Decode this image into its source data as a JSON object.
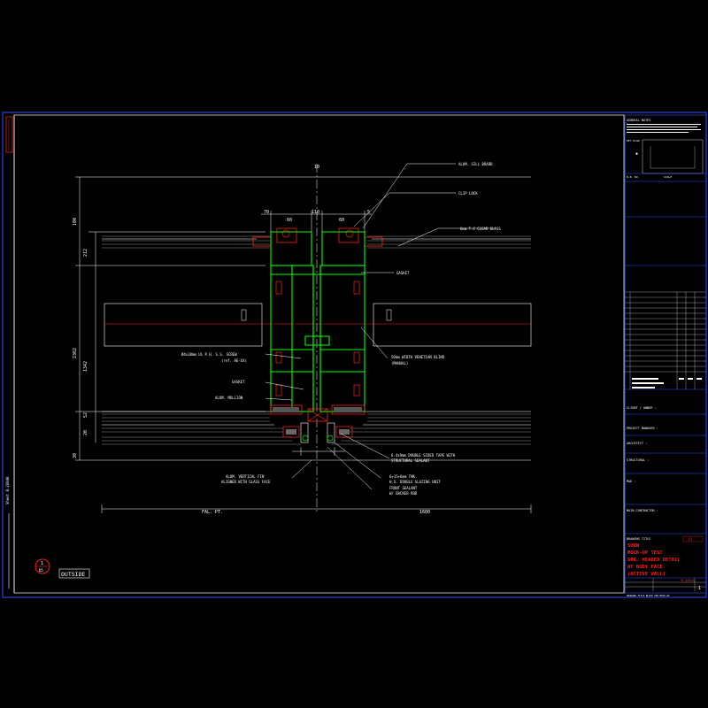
{
  "drawing": {
    "labels": {
      "wall_board": "ALUM. SILL BOARD",
      "clip_lock": "CLIP LOCK",
      "clear_glass": "6mm T.C CLEAR GLASS",
      "gasket_top": "GASKET",
      "blind": "50mm WIDTH VENETIAN BLIND",
      "blind_2": "(MANUAL)",
      "screw": "Ø4x38mm UL P.H. S.S. SCREW",
      "screw_2": "(ref. AE-XX)",
      "gasket_left": "GASKET",
      "mullion": "ALUM. MULLION",
      "tape": "6.4x9mm DOUBLE SIDED TAPE WITH",
      "tape_2": "STRUCTURAL SEALANT",
      "glazing": "6+15+6mm THK.",
      "glazing_2": "H.S. DOUBLE GLAZING UNIT",
      "fin": "ALUM. VERTICAL FIN",
      "fin_2": "ALIGNED WITH GLASS FACE",
      "sealant": "FRONT SEALANT",
      "sealant_2": "W/ BACKER ROD",
      "dim_left": "FAL. PT.",
      "dim_right": "1600",
      "dim_top": "10",
      "dim_60a": "60",
      "dim_60b": "60",
      "dim_70": "70",
      "dim_110": "110",
      "dim_5": "5",
      "dim_v1": "100",
      "dim_v2": "1342",
      "dim_v3": "2362",
      "dim_v4": "212",
      "dim_v5": "52",
      "dim_v6": "20",
      "dim_v7": "30",
      "outside": "OUTSIDE",
      "section_num": "1",
      "section_ref": "D5",
      "border_text": "Sheet B-2004A"
    }
  },
  "title_block": {
    "notes_header": "GENERAL NOTES",
    "key_plan": "KEY PLAN",
    "scale_label": "N.B. NO.",
    "scale_value": "SCALE",
    "rows": [
      "CLIENT / OWNER :",
      "PROJECT MANAGER :",
      "ARCHITECT :",
      "STRUCTURAL :",
      "M&E :",
      "MAIN CONTRACTOR :"
    ],
    "drawing_title_label": "DRAWING TITLE",
    "drawing_title_lines": [
      "SHOW",
      "MOCK-UP TEST",
      "GRG. HEADED DETAIL",
      "AT BODY FACE",
      "(ACTIVE WALL)"
    ],
    "rev": "A1",
    "drawing_no": "B-2004A",
    "revision": "1",
    "footer": "DRAWING TITLE BLOCK FOR MOCK-UP"
  },
  "colors": {
    "green": "#00ff00",
    "red": "#ff2020",
    "white": "#ffffff",
    "blue": "#3050ff",
    "gray": "#909090"
  }
}
